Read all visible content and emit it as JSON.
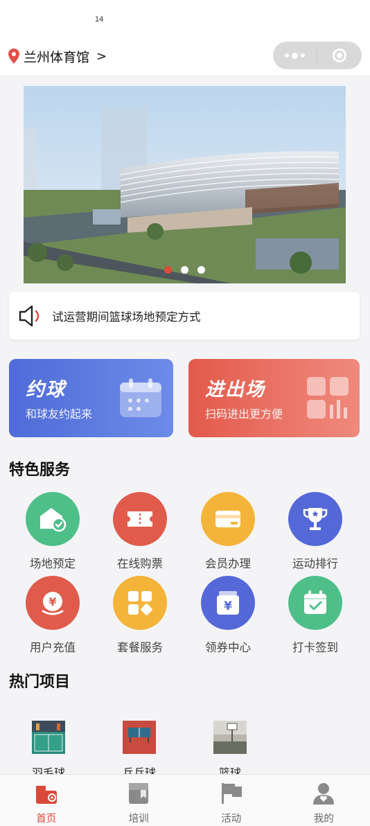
{
  "status_bar": {
    "time": "14"
  },
  "nav": {
    "location_name": "兰州体育馆",
    "location_arrow": ">"
  },
  "banner": {
    "slide_count": 3,
    "active_index": 0
  },
  "notice": {
    "text": "试运营期间篮球场地预定方式"
  },
  "cards": [
    {
      "title": "约球",
      "subtitle": "和球友约起来",
      "icon": "calendar-icon",
      "color": "#5674dc"
    },
    {
      "title": "进出场",
      "subtitle": "扫码进出更方便",
      "icon": "grid-icon",
      "color": "#e66557"
    }
  ],
  "services": {
    "title": "特色服务",
    "items": [
      {
        "label": "场地预定",
        "icon": "venue-check-icon",
        "color": "#4fbf8a"
      },
      {
        "label": "在线购票",
        "icon": "ticket-icon",
        "color": "#e05b4c"
      },
      {
        "label": "会员办理",
        "icon": "card-icon",
        "color": "#f4b43a"
      },
      {
        "label": "运动排行",
        "icon": "trophy-icon",
        "color": "#5568d8"
      },
      {
        "label": "用户充值",
        "icon": "yuan-coin-icon",
        "color": "#e05b4c"
      },
      {
        "label": "套餐服务",
        "icon": "blocks-icon",
        "color": "#f4b43a"
      },
      {
        "label": "领券中心",
        "icon": "coupon-icon",
        "color": "#5568d8"
      },
      {
        "label": "打卡签到",
        "icon": "calendar-check-icon",
        "color": "#4fbf8a"
      }
    ]
  },
  "hot": {
    "title": "热门项目",
    "items": [
      {
        "label": "羽毛球",
        "icon": "badminton-court-thumb"
      },
      {
        "label": "乒乓球",
        "icon": "table-tennis-thumb"
      },
      {
        "label": "篮球",
        "icon": "basketball-court-thumb"
      }
    ]
  },
  "tabbar": {
    "items": [
      {
        "label": "首页",
        "icon": "home-icon",
        "active": true
      },
      {
        "label": "培训",
        "icon": "training-icon",
        "active": false
      },
      {
        "label": "活动",
        "icon": "flag-icon",
        "active": false
      },
      {
        "label": "我的",
        "icon": "user-icon",
        "active": false
      }
    ],
    "active_color": "#d9493a",
    "inactive_color": "#8a8a8a"
  }
}
